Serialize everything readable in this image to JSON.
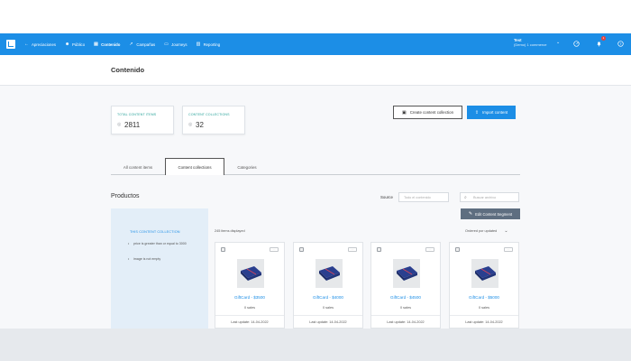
{
  "nav": {
    "items": [
      {
        "label": "Apreciaciones",
        "icon": "back-arrow-icon"
      },
      {
        "label": "Público",
        "icon": "users-icon"
      },
      {
        "label": "Contenido",
        "icon": "content-icon"
      },
      {
        "label": "Campañas",
        "icon": "send-icon"
      },
      {
        "label": "Journeys",
        "icon": "journey-icon"
      },
      {
        "label": "Reporting",
        "icon": "chart-icon"
      }
    ],
    "account_name": "Test",
    "account_sub": "(Demo) 1 commerce",
    "notification_count": "1"
  },
  "page": {
    "title": "Contenido"
  },
  "stats": [
    {
      "label": "TOTAL CONTENT ITEMS",
      "value": "2811"
    },
    {
      "label": "CONTENT COLLECTIONS",
      "value": "32"
    }
  ],
  "actions": {
    "create_collection": "Create content collection",
    "import_content": "Import content"
  },
  "tabs": [
    "All content items",
    "Content collections",
    "Categories"
  ],
  "section": {
    "title": "Productos",
    "source_label": "Source",
    "source_placeholder": "Todo el contenido",
    "search_placeholder": "Buscar archivo",
    "edit_segment": "Edit Content Segment",
    "items_count": "245 items displayed",
    "ordered_by": "Ordered por updated"
  },
  "collection_panel": {
    "title": "THIS CONTENT COLLECTION",
    "rules": [
      "price is greater than or equal to 3000",
      "image is not empty"
    ]
  },
  "products": [
    {
      "name": "GiftCard - $3500",
      "sales": "0 sales",
      "updated": "Last update: 14-04-2022"
    },
    {
      "name": "GiftCard - $4000",
      "sales": "0 sales",
      "updated": "Last update: 14-04-2022"
    },
    {
      "name": "GiftCard - $4500",
      "sales": "0 sales",
      "updated": "Last update: 14-04-2022"
    },
    {
      "name": "GiftCard - $5000",
      "sales": "0 sales",
      "updated": "Last update: 14-04-2022"
    }
  ]
}
